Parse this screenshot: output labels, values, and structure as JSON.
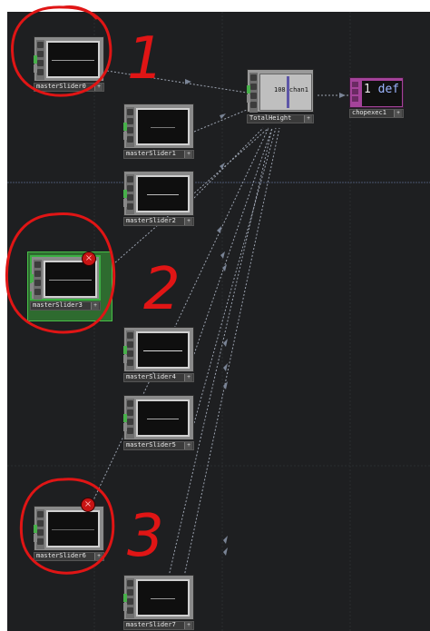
{
  "nodes": {
    "masterSlider0": {
      "name": "masterSlider0"
    },
    "masterSlider1": {
      "name": "masterSlider1"
    },
    "masterSlider2": {
      "name": "masterSlider2"
    },
    "masterSlider3": {
      "name": "masterSlider3"
    },
    "masterSlider4": {
      "name": "masterSlider4"
    },
    "masterSlider5": {
      "name": "masterSlider5"
    },
    "masterSlider6": {
      "name": "masterSlider6"
    },
    "masterSlider7": {
      "name": "masterSlider7"
    },
    "totalHeight": {
      "name": "TotalHeight",
      "value_text": "108 chan1"
    },
    "chopexec": {
      "name": "chopexec1",
      "code_line": "1",
      "code_text": "def"
    }
  },
  "annotations": {
    "label1": "1",
    "label2": "2",
    "label3": "3"
  },
  "badges": {
    "error_icon": "×",
    "node_menu": "+"
  },
  "colors": {
    "selected": "#3cb043",
    "error": "#c81414",
    "annotation": "#e01515",
    "exec": "#a4439a"
  }
}
